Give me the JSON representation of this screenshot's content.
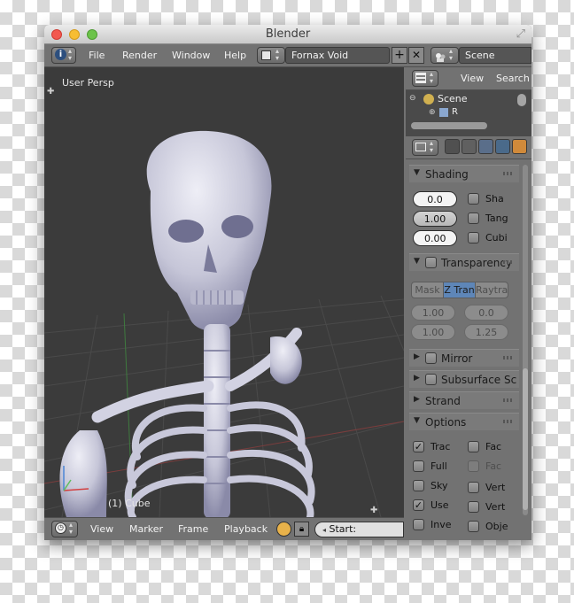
{
  "window": {
    "title": "Blender"
  },
  "info_header": {
    "menus": [
      "File",
      "Render",
      "Window",
      "Help"
    ],
    "layout_name": "Fornax Void",
    "scene_name": "Scene"
  },
  "viewport": {
    "view_label": "User Persp",
    "object_label": "(1) Cube"
  },
  "outliner": {
    "menus": [
      "View",
      "Search"
    ],
    "tree": [
      "Scene",
      "R"
    ]
  },
  "properties": {
    "shading": {
      "title": "Shading",
      "emit": "0.0",
      "ambient": "1.00",
      "translucency": "0.00",
      "checks": [
        "Sha",
        "Tang",
        "Cubi"
      ]
    },
    "transparency": {
      "title": "Transparency",
      "modes": [
        "Mask",
        "Z Tran",
        "Raytra"
      ],
      "active_mode": "Z Tran",
      "values": [
        "1.00",
        "0.0",
        "1.00",
        "1.25"
      ]
    },
    "mirror": {
      "title": "Mirror"
    },
    "subsurface": {
      "title": "Subsurface Sc"
    },
    "strand": {
      "title": "Strand"
    },
    "options": {
      "title": "Options",
      "left": [
        {
          "label": "Trac",
          "checked": true,
          "dim": false
        },
        {
          "label": "Full",
          "checked": false,
          "dim": false
        },
        {
          "label": "Sky",
          "checked": false,
          "dim": false
        },
        {
          "label": "Use",
          "checked": true,
          "dim": false
        },
        {
          "label": "Inve",
          "checked": false,
          "dim": false
        }
      ],
      "right": [
        {
          "label": "Fac",
          "checked": false,
          "dim": false
        },
        {
          "label": "Fac",
          "checked": false,
          "dim": true
        },
        {
          "label": "Vert",
          "checked": false,
          "dim": false
        },
        {
          "label": "Vert",
          "checked": false,
          "dim": false
        },
        {
          "label": "Obje",
          "checked": false,
          "dim": false
        }
      ]
    }
  },
  "timeline": {
    "menus": [
      "View",
      "Marker",
      "Frame",
      "Playback"
    ],
    "start_label": "Start:"
  },
  "colors": {
    "viewport_bg": "#3b3b3b",
    "header_bg": "#727272",
    "active_blue": "#5e86b8",
    "skeleton": "#c9c9db"
  }
}
